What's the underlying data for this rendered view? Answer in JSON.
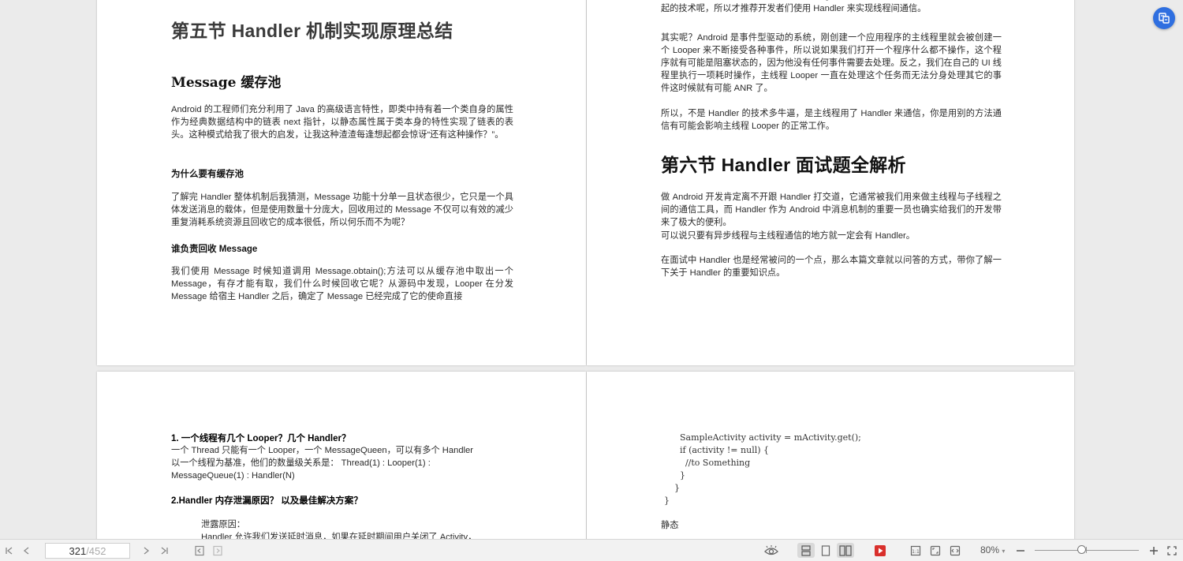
{
  "doc": {
    "p1": {
      "section_title": "第五节 Handler 机制实现原理总结",
      "sub_title": "Message 缓存池",
      "para1": "Android 的工程师们充分利用了 Java 的高级语言特性，即类中持有着一个类自身的属性作为经典数据结构中的链表 next 指针，以静态属性属于类本身的特性实现了链表的表头。这种模式给我了很大的启发，让我这种渣渣每逢想起都会惊讶“还有这种操作？”。",
      "h_why": "为什么要有缓存池",
      "para2": "了解完 Handler 整体机制后我猜测，Message 功能十分单一且状态很少，它只是一个具体发送消息的载体，但是使用数量十分庞大，回收用过的 Message 不仅可以有效的减少重复消耗系统资源且回收它的成本很低，所以何乐而不为呢？",
      "h_who": "谁负责回收 Message",
      "para3": "我们使用 Message 时候知道调用 Message.obtain();方法可以从缓存池中取出一个 Message，有存才能有取，我们什么时候回收它呢？从源码中发现，Looper 在分发 Message 给宿主 Handler 之后，确定了 Message 已经完成了它的使命直接"
    },
    "p2": {
      "top_para": "在没有真正了解 Handler 的时候以为 Google 的工程师们在 Handler 上使用了什么了不起的技术呢，所以才推荐开发者们使用 Handler 来实现线程间通信。",
      "para1": "其实呢？Android 是事件型驱动的系统，刚创建一个应用程序的主线程里就会被创建一个 Looper 来不断接受各种事件，所以说如果我们打开一个程序什么都不操作，这个程序就有可能是阻塞状态的，因为他没有任何事件需要去处理。反之，我们在自己的 UI 线程里执行一项耗时操作，主线程 Looper 一直在处理这个任务而无法分身处理其它的事件这时候就有可能 ANR 了。",
      "para2": "所以，不是 Handler 的技术多牛逼，是主线程用了 Handler 来通信，你是用别的方法通信有可能会影响主线程 Looper 的正常工作。",
      "section_title": "第六节 Handler 面试题全解析",
      "para3": "做 Android 开发肯定离不开跟 Handler 打交道，它通常被我们用来做主线程与子线程之间的通信工具，而 Handler 作为 Android 中消息机制的重要一员也确实给我们的开发带来了极大的便利。",
      "para3b": "可以说只要有异步线程与主线程通信的地方就一定会有 Handler。",
      "para4": "在面试中 Handler 也是经常被问的一个点，那么本篇文章就以问答的方式，带你了解一下关于 Handler 的重要知识点。"
    },
    "p3": {
      "q1_title": "1.  一个线程有几个 Looper？几个 Handler？",
      "q1_line1": "一个 Thread 只能有一个 Looper，一个 MessageQueen，可以有多个 Handler",
      "q1_line2": "以一个线程为基准，他们的数量级关系是： Thread(1) : Looper(1) :",
      "q1_line3": "MessageQueue(1) : Handler(N)",
      "q2_title": "2.Handler  内存泄漏原因？  以及最佳解决方案？",
      "leak_label": "泄露原因：",
      "leak_line": "Handler  允许我们发送延时消息，如果在延时期间用户关闭了 Activity，"
    },
    "p4": {
      "code_lines": [
        "    SampleActivity activity = mActivity.get();",
        "    if (activity != null) {",
        "      //to Something",
        "    }",
        "  }",
        "}"
      ],
      "tail": "静态"
    }
  },
  "toolbar": {
    "current_page": "321",
    "total_pages": "/452",
    "zoom": "80%",
    "zoom_fraction": 0.45
  },
  "colors": {
    "accent": "#2f6fe0",
    "play_red": "#d9302c"
  }
}
